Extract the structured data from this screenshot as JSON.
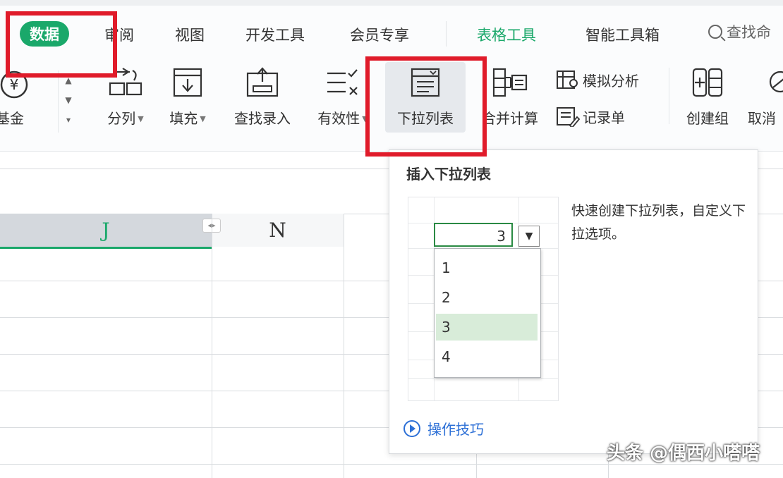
{
  "tabs": {
    "data": "数据",
    "review": "审阅",
    "view": "视图",
    "dev_tools": "开发工具",
    "member": "会员专享",
    "table_tools": "表格工具",
    "smart_tools": "智能工具箱",
    "search": "查找命"
  },
  "ribbon": {
    "fund": "基金",
    "split": "分列",
    "fill": "填充",
    "find_entry": "查找录入",
    "validity": "有效性",
    "dropdown_list": "下拉列表",
    "merge_calc": "合并计算",
    "simulate": "模拟分析",
    "record_sheet": "记录单",
    "create_group": "创建组",
    "ungroup": "取消"
  },
  "grid": {
    "col_j": "J",
    "col_n": "N"
  },
  "tooltip": {
    "title": "插入下拉列表",
    "description": "快速创建下拉列表，自定义下拉选项。",
    "cell_value": "3",
    "options": [
      "1",
      "2",
      "3",
      "4"
    ],
    "selected": "3",
    "tips_link": "操作技巧"
  },
  "watermark": "头条 @偶西小嗒嗒",
  "colors": {
    "accent": "#1aa86a",
    "annotation": "#e01b2a",
    "link": "#2c6fd6"
  }
}
